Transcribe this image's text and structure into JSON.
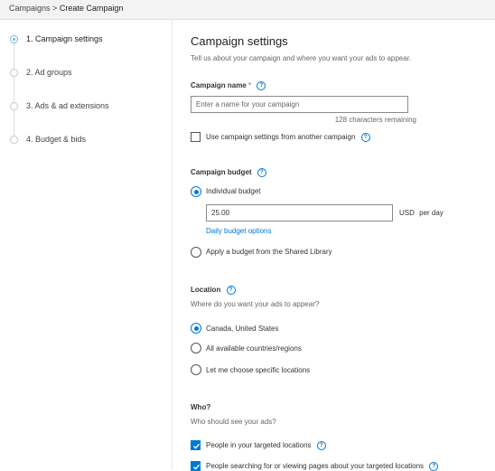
{
  "breadcrumb": {
    "parent": "Campaigns",
    "separator": ">",
    "current": "Create Campaign"
  },
  "steps": [
    {
      "label": "1. Campaign settings",
      "active": true
    },
    {
      "label": "2. Ad groups",
      "active": false
    },
    {
      "label": "3. Ads & ad extensions",
      "active": false
    },
    {
      "label": "4. Budget & bids",
      "active": false
    }
  ],
  "settings": {
    "title": "Campaign settings",
    "subtitle": "Tell us about your campaign and where you want your ads to appear."
  },
  "campaign_name": {
    "label": "Campaign name",
    "required_marker": "*",
    "value": "",
    "placeholder": "Enter a name for your campaign",
    "chars_remaining": "128 characters remaining",
    "copy_settings_label": "Use campaign settings from another campaign",
    "copy_settings_checked": false
  },
  "budget": {
    "label": "Campaign budget",
    "individual_label": "Individual budget",
    "individual_selected": true,
    "amount": "25.00",
    "currency": "USD",
    "period": "per day",
    "options_link": "Daily budget options",
    "shared_label": "Apply a budget from the Shared Library",
    "shared_selected": false
  },
  "location": {
    "label": "Location",
    "question": "Where do you want your ads to appear?",
    "options": [
      {
        "label": "Canada, United States",
        "selected": true
      },
      {
        "label": "All available countries/regions",
        "selected": false
      },
      {
        "label": "Let me choose specific locations",
        "selected": false
      }
    ]
  },
  "who": {
    "label": "Who?",
    "question": "Who should see your ads?",
    "options": [
      {
        "label": "People in your targeted locations",
        "checked": true
      },
      {
        "label": "People searching for or viewing pages about your targeted locations",
        "checked": true
      }
    ]
  },
  "icons": {
    "help": "help-circle-icon",
    "check": "checkmark-icon",
    "step": "step-dot-icon"
  },
  "colors": {
    "accent": "#0078d4",
    "required": "#d13438",
    "step_active": "#7fb2e5"
  }
}
